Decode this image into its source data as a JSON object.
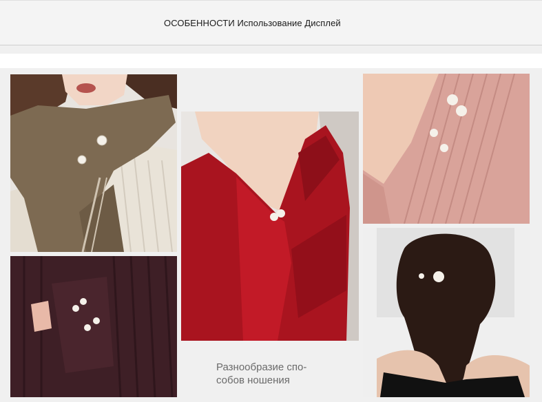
{
  "header": {
    "title": "ОСОБЕННОСТИ Использование Дисплей"
  },
  "caption": {
    "line1": "Разнообразие спо-",
    "line2": "собов ношения"
  },
  "photos": [
    {
      "subject": "scarf-pins"
    },
    {
      "subject": "cuff-pins"
    },
    {
      "subject": "red-dress-pin"
    },
    {
      "subject": "pink-top-pins"
    },
    {
      "subject": "hair-pin"
    }
  ],
  "colors": {
    "background": "#f0f0f0",
    "scarf": "#7d6a52",
    "sweater": "#e9e3d8",
    "cardigan": "#3e1f26",
    "dress": "#a9141f",
    "pink_top": "#d9a39a",
    "pearl": "#f5f1ea"
  }
}
